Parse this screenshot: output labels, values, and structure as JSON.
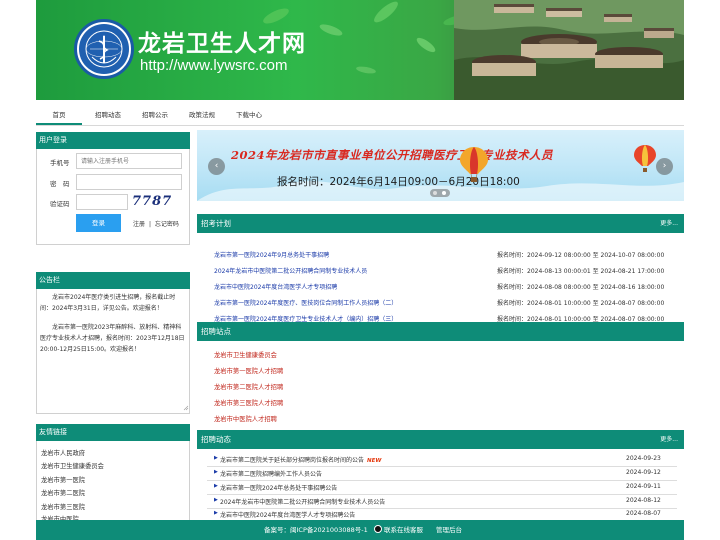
{
  "header": {
    "title": "龙岩卫生人才网",
    "url": "http://www.lywsrc.com",
    "brand_color": "#2fb84a"
  },
  "nav": {
    "items": [
      {
        "label": "首页",
        "active": true
      },
      {
        "label": "招聘动态",
        "active": false
      },
      {
        "label": "招聘公示",
        "active": false
      },
      {
        "label": "政策法规",
        "active": false
      },
      {
        "label": "下载中心",
        "active": false
      }
    ]
  },
  "login": {
    "title": "用户登录",
    "phone_label": "手机号",
    "phone_placeholder": "请输入注册手机号",
    "password_label": "密　码",
    "password_value": "",
    "captcha_label": "验证码",
    "captcha_value": "",
    "captcha_text": "7787",
    "login_button": "登录",
    "register_link": "注册",
    "separator": "|",
    "forgot_link": "忘记密码"
  },
  "notice": {
    "title": "公告栏",
    "paragraphs": [
      "龙岩市2024年医疗类引进生招聘，报名截止时间：2024年3月31日，详见公告。欢迎报名！",
      "龙岩市第一医院2023年麻醉科、放射科、精神科医疗专业技术人才招聘，报名时间：2023年12月18日20:00-12月25日15:00。欢迎报名！"
    ]
  },
  "friend_links": {
    "title": "友情链接",
    "items": [
      "龙岩市人民政府",
      "龙岩市卫生健康委员会",
      "龙岩市第一医院",
      "龙岩市第二医院",
      "龙岩市第三医院",
      "龙岩市中医院"
    ]
  },
  "banner": {
    "title": "2024年龙岩市市直事业单位公开招聘医疗卫生专业技术人员",
    "time": "报名时间：2024年6月14日09:00－6月20日18:00",
    "prev_arrow": "‹",
    "next_arrow": "›"
  },
  "plan": {
    "title": "招考计划",
    "more": "更多...",
    "items": [
      {
        "title": "龙岩市第一医院2024年9月总务处干事招聘",
        "time": "报名时间：2024-09-12 08:00:00 至 2024-10-07 08:00:00"
      },
      {
        "title": "2024年龙岩市中医院第二批公开招聘合同制专业技术人员",
        "time": "报名时间：2024-08-13 00:00:01 至 2024-08-21 17:00:00"
      },
      {
        "title": "龙岩市中医院2024年度台湾医学人才专项招聘",
        "time": "报名时间：2024-08-08 08:00:00 至 2024-08-16 18:00:00"
      },
      {
        "title": "龙岩市第一医院2024年度医疗、医技岗位合同制工作人员招聘（二）",
        "time": "报名时间：2024-08-01 10:00:00 至 2024-08-07 08:00:00"
      },
      {
        "title": "龙岩市第一医院2024年度医疗卫生专业技术人才（编内）招聘（三）",
        "time": "报名时间：2024-08-01 10:00:00 至 2024-08-07 08:00:00"
      }
    ]
  },
  "stations": {
    "title": "招聘站点",
    "items": [
      "龙岩市卫生健康委员会",
      "龙岩市第一医院人才招聘",
      "龙岩市第二医院人才招聘",
      "龙岩市第三医院人才招聘",
      "龙岩市中医院人才招聘"
    ]
  },
  "news": {
    "title": "招聘动态",
    "more": "更多...",
    "new_badge": "NEW",
    "items": [
      {
        "title": "龙岩市第二医院关于延长部分招聘岗位报名时间的公告",
        "date": "2024-09-23",
        "is_new": true
      },
      {
        "title": "龙岩市第二医院招聘编外工作人员公告",
        "date": "2024-09-12",
        "is_new": false
      },
      {
        "title": "龙岩市第一医院2024年总务处干事招聘公告",
        "date": "2024-09-11",
        "is_new": false
      },
      {
        "title": "2024年龙岩市中医院第二批公开招聘合同制专业技术人员公告",
        "date": "2024-08-12",
        "is_new": false
      },
      {
        "title": "龙岩市中医院2024年度台湾医学人才专项招聘公告",
        "date": "2024-08-07",
        "is_new": false
      }
    ]
  },
  "footer": {
    "icp": "备案号：闽ICP备2021003088号-1",
    "service": "联系在线客服",
    "admin": "管理后台"
  },
  "theme": {
    "accent": "#0e8c78",
    "link_blue": "#1a3aa8",
    "link_red": "#c0261b",
    "button_blue": "#2a9ff0"
  }
}
